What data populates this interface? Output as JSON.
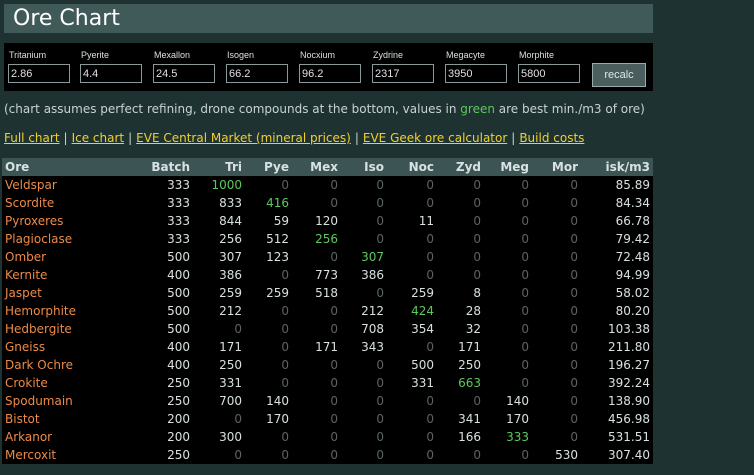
{
  "title": "Ore Chart",
  "prices": [
    {
      "label": "Tritanium",
      "value": "2.86"
    },
    {
      "label": "Pyerite",
      "value": "4.4"
    },
    {
      "label": "Mexallon",
      "value": "24.5"
    },
    {
      "label": "Isogen",
      "value": "66.2"
    },
    {
      "label": "Nocxium",
      "value": "96.2"
    },
    {
      "label": "Zydrine",
      "value": "2317"
    },
    {
      "label": "Megacyte",
      "value": "3950"
    },
    {
      "label": "Morphite",
      "value": "5800"
    }
  ],
  "recalc_label": "recalc",
  "note": {
    "before": "(chart assumes perfect refining, drone compounds at the bottom, values in ",
    "highlight": "green",
    "after": " are best min./m3 of ore)",
    "highlight_color": "#5cc85c"
  },
  "links": [
    "Full chart",
    "Ice chart",
    "EVE Central Market (mineral prices)",
    "EVE Geek ore calculator",
    "Build costs"
  ],
  "link_separator": "|",
  "table": {
    "headers": [
      "Ore",
      "Batch",
      "Tri",
      "Pye",
      "Mex",
      "Iso",
      "Noc",
      "Zyd",
      "Meg",
      "Mor",
      "isk/m3"
    ],
    "rows": [
      {
        "name": "Veldspar",
        "values": [
          "333",
          "1000",
          "0",
          "0",
          "0",
          "0",
          "0",
          "0",
          "0",
          "85.89"
        ],
        "best": [
          1
        ]
      },
      {
        "name": "Scordite",
        "values": [
          "333",
          "833",
          "416",
          "0",
          "0",
          "0",
          "0",
          "0",
          "0",
          "84.34"
        ],
        "best": [
          2
        ]
      },
      {
        "name": "Pyroxeres",
        "values": [
          "333",
          "844",
          "59",
          "120",
          "0",
          "11",
          "0",
          "0",
          "0",
          "66.78"
        ],
        "best": []
      },
      {
        "name": "Plagioclase",
        "values": [
          "333",
          "256",
          "512",
          "256",
          "0",
          "0",
          "0",
          "0",
          "0",
          "79.42"
        ],
        "best": [
          3
        ]
      },
      {
        "name": "Omber",
        "values": [
          "500",
          "307",
          "123",
          "0",
          "307",
          "0",
          "0",
          "0",
          "0",
          "72.48"
        ],
        "best": [
          4
        ]
      },
      {
        "name": "Kernite",
        "values": [
          "400",
          "386",
          "0",
          "773",
          "386",
          "0",
          "0",
          "0",
          "0",
          "94.99"
        ],
        "best": []
      },
      {
        "name": "Jaspet",
        "values": [
          "500",
          "259",
          "259",
          "518",
          "0",
          "259",
          "8",
          "0",
          "0",
          "58.02"
        ],
        "best": []
      },
      {
        "name": "Hemorphite",
        "values": [
          "500",
          "212",
          "0",
          "0",
          "212",
          "424",
          "28",
          "0",
          "0",
          "80.20"
        ],
        "best": [
          5
        ]
      },
      {
        "name": "Hedbergite",
        "values": [
          "500",
          "0",
          "0",
          "0",
          "708",
          "354",
          "32",
          "0",
          "0",
          "103.38"
        ],
        "best": []
      },
      {
        "name": "Gneiss",
        "values": [
          "400",
          "171",
          "0",
          "171",
          "343",
          "0",
          "171",
          "0",
          "0",
          "211.80"
        ],
        "best": []
      },
      {
        "name": "Dark Ochre",
        "values": [
          "400",
          "250",
          "0",
          "0",
          "0",
          "500",
          "250",
          "0",
          "0",
          "196.27"
        ],
        "best": []
      },
      {
        "name": "Crokite",
        "values": [
          "250",
          "331",
          "0",
          "0",
          "0",
          "331",
          "663",
          "0",
          "0",
          "392.24"
        ],
        "best": [
          6
        ]
      },
      {
        "name": "Spodumain",
        "values": [
          "250",
          "700",
          "140",
          "0",
          "0",
          "0",
          "0",
          "140",
          "0",
          "138.90"
        ],
        "best": []
      },
      {
        "name": "Bistot",
        "values": [
          "200",
          "0",
          "170",
          "0",
          "0",
          "0",
          "341",
          "170",
          "0",
          "456.98"
        ],
        "best": []
      },
      {
        "name": "Arkanor",
        "values": [
          "200",
          "300",
          "0",
          "0",
          "0",
          "0",
          "166",
          "333",
          "0",
          "531.51"
        ],
        "best": [
          7
        ]
      },
      {
        "name": "Mercoxit",
        "values": [
          "250",
          "0",
          "0",
          "0",
          "0",
          "0",
          "0",
          "0",
          "530",
          "307.40"
        ],
        "best": []
      }
    ]
  }
}
